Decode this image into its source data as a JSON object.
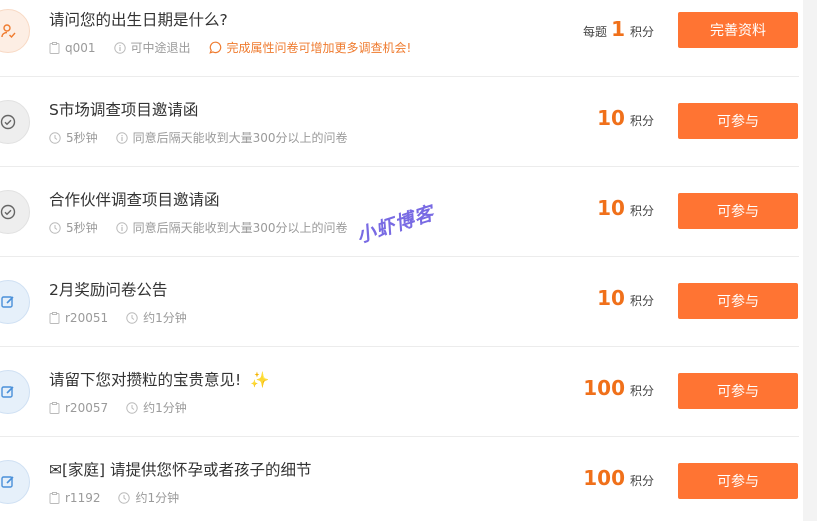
{
  "surveys": [
    {
      "title": "请问您的出生日期是什么?",
      "meta1": "q001",
      "meta2": "可中途退出",
      "hint": "完成属性问卷可增加更多调查机会!",
      "points_prefix": "每题",
      "points": "1",
      "unit": "积分",
      "button": "完善资料",
      "status_icon": "user-check-icon"
    },
    {
      "title": "S市场调查项目邀请函",
      "meta1": "5秒钟",
      "meta2": "同意后隔天能收到大量300分以上的问卷",
      "points": "10",
      "unit": "积分",
      "button": "可参与",
      "status_icon": "check-circle-icon"
    },
    {
      "title": "合作伙伴调查项目邀请函",
      "meta1": "5秒钟",
      "meta2": "同意后隔天能收到大量300分以上的问卷",
      "points": "10",
      "unit": "积分",
      "button": "可参与",
      "status_icon": "check-circle-icon"
    },
    {
      "title": "2月奖励问卷公告",
      "meta1": "r20051",
      "meta2": "约1分钟",
      "points": "10",
      "unit": "积分",
      "button": "可参与",
      "status_icon": "edit-icon"
    },
    {
      "title": "请留下您对攒粒的宝贵意见!",
      "title_emoji": "✨",
      "meta1": "r20057",
      "meta2": "约1分钟",
      "points": "100",
      "unit": "积分",
      "button": "可参与",
      "status_icon": "edit-icon"
    },
    {
      "title": "✉[家庭] 请提供您怀孕或者孩子的细节",
      "meta1": "r1192",
      "meta2": "约1分钟",
      "points": "100",
      "unit": "积分",
      "button": "可参与",
      "status_icon": "edit-icon"
    }
  ],
  "watermark": "小虾博客",
  "colors": {
    "accent": "#ff7433",
    "points": "#f0701a",
    "hint": "#ef7b2f",
    "edit_blue": "#4a90d9"
  }
}
